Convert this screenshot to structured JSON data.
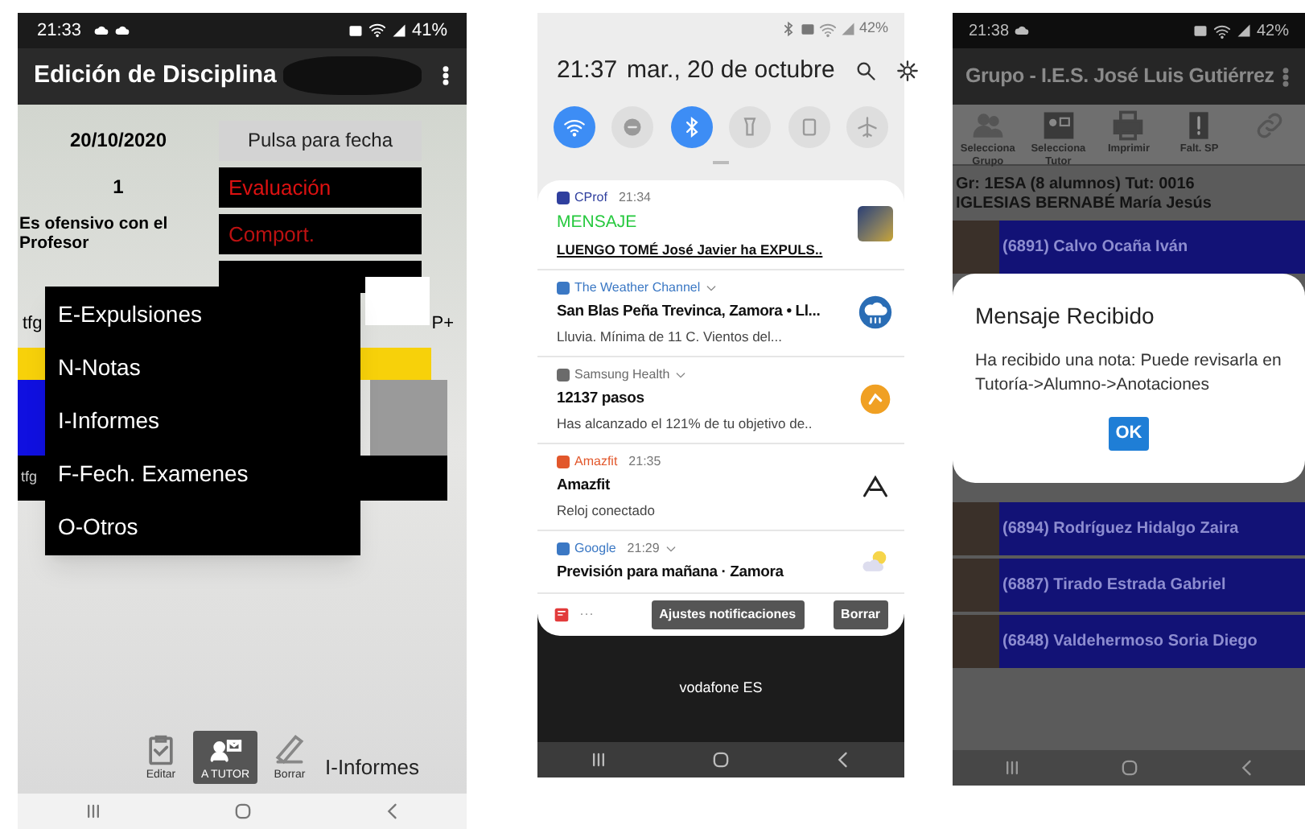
{
  "discipline_screen": {
    "status_bar": {
      "time": "21:33",
      "battery": "41%"
    },
    "title": "Edición de Disciplina",
    "form": {
      "date": "20/10/2020",
      "date_button": "Pulsa para fecha",
      "evaluation_value": "1",
      "evaluation_button": "Evaluación",
      "behaviour_value": "Es ofensivo con el Profesor",
      "behaviour_button": "Comport.",
      "field_label": "tfg",
      "field_suffix": "P+",
      "second_label": "tfg"
    },
    "menu": [
      {
        "label": "E-Expulsiones"
      },
      {
        "label": "N-Notas"
      },
      {
        "label": "I-Informes"
      },
      {
        "label": "F-Fech. Examenes"
      },
      {
        "label": "O-Otros"
      }
    ],
    "toolbar": [
      {
        "kind": "clipboard",
        "label": "Editar",
        "selected": false
      },
      {
        "kind": "contact",
        "label": "A TUTOR",
        "selected": true
      },
      {
        "kind": "eraser",
        "label": "Borrar",
        "selected": false
      }
    ],
    "toolbar_label": "I-Informes"
  },
  "notification_shade": {
    "status_bar": {
      "battery": "42%"
    },
    "header": {
      "time": "21:37",
      "date": "mar., 20 de octubre"
    },
    "toggles": [
      {
        "kind": "wifi",
        "on": true
      },
      {
        "kind": "dnd",
        "on": false
      },
      {
        "kind": "bluetooth",
        "on": true
      },
      {
        "kind": "flashlight",
        "on": false
      },
      {
        "kind": "rotate",
        "on": false
      },
      {
        "kind": "airplane",
        "on": false
      }
    ],
    "notifications": [
      {
        "kind": "cprof",
        "app": "CProf",
        "color": "#2f3f9e",
        "time": "21:34",
        "expandable": false,
        "title": "MENSAJE",
        "text": "LUENGO TOMÉ José Javier ha EXPULS.."
      },
      {
        "kind": "weather",
        "app": "The Weather Channel",
        "color": "#3b78c4",
        "expandable": true,
        "title": "San Blas Peña Trevinca, Zamora • Ll...",
        "text": "Lluvia. Mínima de 11 C. Vientos del..."
      },
      {
        "kind": "health",
        "app": "Samsung Health",
        "color": "#6b6b6b",
        "expandable": true,
        "title": "12137 pasos",
        "text": "Has alcanzado el 121% de tu objetivo de.."
      },
      {
        "kind": "amazfit",
        "app": "Amazfit",
        "color": "#e2572b",
        "time": "21:35",
        "expandable": false,
        "title": "Amazfit",
        "text": "Reloj conectado"
      },
      {
        "kind": "google",
        "app": "Google",
        "color": "#3b78c4",
        "time": "21:29",
        "expandable": true,
        "title": "Previsión para mañana · Zamora"
      }
    ],
    "footer": {
      "more": "···",
      "buttons": [
        "Ajustes notificaciones",
        "Borrar"
      ]
    },
    "carrier": "vodafone ES"
  },
  "group_screen": {
    "status_bar": {
      "time": "21:38",
      "battery": "42%"
    },
    "title": "Grupo - I.E.S. José Luis Gutiérrez",
    "toolbar": [
      {
        "kind": "group",
        "label": "Selecciona Grupo"
      },
      {
        "kind": "tutor",
        "label": "Selecciona Tutor"
      },
      {
        "kind": "print",
        "label": "Imprimir"
      },
      {
        "kind": "alert",
        "label": "Falt. SP"
      },
      {
        "kind": "link"
      }
    ],
    "info": [
      "Gr: 1ESA (8 alumnos) Tut: 0016",
      "IGLESIAS BERNABÉ María Jesús"
    ],
    "students": [
      {
        "name": "(6891) Calvo Ocaña Iván"
      },
      {
        "name": "(6894) Rodríguez Hidalgo Zaira"
      },
      {
        "name": "(6887) Tirado Estrada Gabriel"
      },
      {
        "name": "(6848) Valdehermoso Soria Diego"
      }
    ],
    "dialog": {
      "title": "Mensaje Recibido",
      "text": "Ha recibido una nota:  Puede revisarla en Tutoría->Alumno->Anotaciones",
      "button": "OK"
    }
  }
}
